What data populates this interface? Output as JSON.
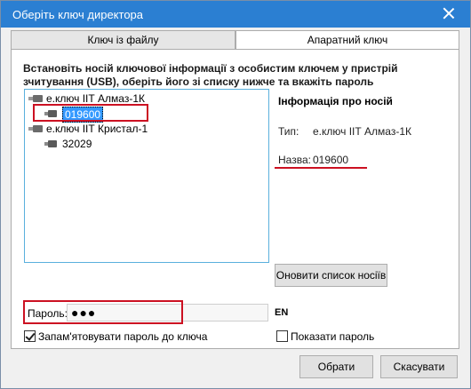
{
  "window": {
    "title": "Оберіть ключ директора"
  },
  "tabs": [
    {
      "label": "Ключ із файлу"
    },
    {
      "label": "Апаратний ключ"
    }
  ],
  "instructions": "Встановіть носій ключової інформації з особистим ключем у пристрій зчитування (USB), оберіть його зі списку нижче та вкажіть пароль",
  "tree": [
    {
      "label": "е.ключ ІІТ Алмаз-1К",
      "children": [
        "019600"
      ]
    },
    {
      "label": "е.ключ ІІТ Кристал-1",
      "children": [
        "32029"
      ]
    }
  ],
  "info": {
    "title": "Інформація про носій",
    "type_label": "Тип:",
    "type_value": "е.ключ ІІТ Алмаз-1К",
    "name_label": "Назва:",
    "name_value": "019600"
  },
  "refresh_button": "Оновити список носіїв",
  "password": {
    "label": "Пароль:",
    "value": "●●●",
    "lang": "EN"
  },
  "remember": {
    "label": "Запам'ятовувати пароль до ключа",
    "checked": true
  },
  "show_password": {
    "label": "Показати пароль",
    "checked": false
  },
  "buttons": {
    "ok": "Обрати",
    "cancel": "Скасувати"
  },
  "colors": {
    "titlebar": "#2b7fd2",
    "highlight": "#cc1122",
    "selection": "#3399ff"
  }
}
